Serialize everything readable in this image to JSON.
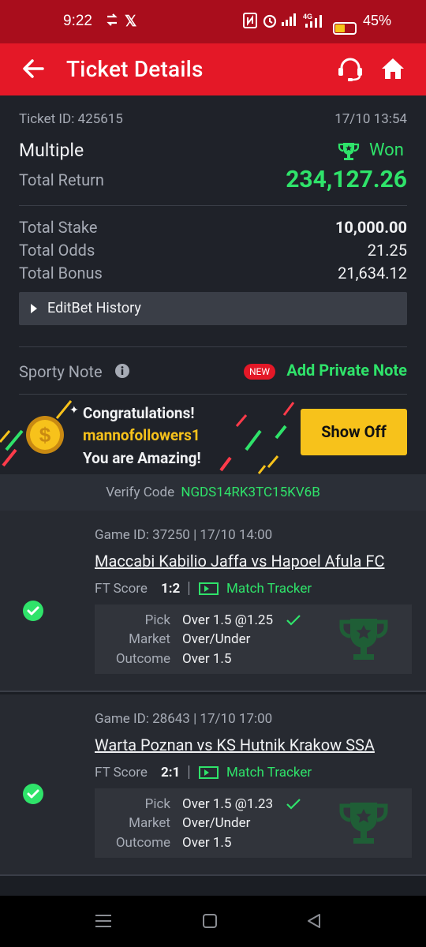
{
  "status_bar": {
    "time": "9:22",
    "battery_pct": "45%",
    "battery_level": 0.45,
    "icons": [
      "data-saver-icon",
      "x-logo-icon",
      "nfc-icon",
      "alarm-icon",
      "signal-icon",
      "4g-signal-icon",
      "battery-icon"
    ]
  },
  "header": {
    "title": "Ticket Details",
    "icons": [
      "back-arrow-icon",
      "support-headset-icon",
      "home-icon"
    ],
    "color": "#e41827"
  },
  "ticket": {
    "id_label": "Ticket ID: 425615",
    "datetime": "17/10 13:54",
    "type": "Multiple",
    "status": "Won",
    "total_return_label": "Total Return",
    "total_return": "234,127.26",
    "total_stake_label": "Total Stake",
    "total_stake": "10,000.00",
    "total_odds_label": "Total Odds",
    "total_odds": "21.25",
    "total_bonus_label": "Total Bonus",
    "total_bonus": "21,634.12",
    "editbet_label": "EditBet History"
  },
  "note": {
    "label": "Sporty Note",
    "new_badge": "NEW",
    "add_label": "Add Private Note"
  },
  "promo": {
    "line1": "Congratulations!",
    "username": "mannofollowers1",
    "line3": "You are Amazing!",
    "button": "Show Off"
  },
  "verify": {
    "label": "Verify Code",
    "code": "NGDS14RK3TC15KV6B"
  },
  "games": [
    {
      "game_id": "Game ID: 37250 | 17/10 14:00",
      "match": "Maccabi Kabilio Jaffa vs Hapoel Afula FC",
      "ft_label": "FT Score",
      "score": "1:2",
      "tracker": "Match Tracker",
      "pick_label": "Pick",
      "pick": "Over 1.5 @1.25",
      "market_label": "Market",
      "market": "Over/Under",
      "outcome_label": "Outcome",
      "outcome": "Over 1.5"
    },
    {
      "game_id": "Game ID: 28643 | 17/10 17:00",
      "match": "Warta Poznan vs KS Hutnik Krakow SSA",
      "ft_label": "FT Score",
      "score": "2:1",
      "tracker": "Match Tracker",
      "pick_label": "Pick",
      "pick": "Over 1.5 @1.23",
      "market_label": "Market",
      "market": "Over/Under",
      "outcome_label": "Outcome",
      "outcome": "Over 1.5"
    }
  ],
  "colors": {
    "won_green": "#2fe36a",
    "brand_red": "#e41827",
    "button_yellow": "#f7c21b"
  }
}
